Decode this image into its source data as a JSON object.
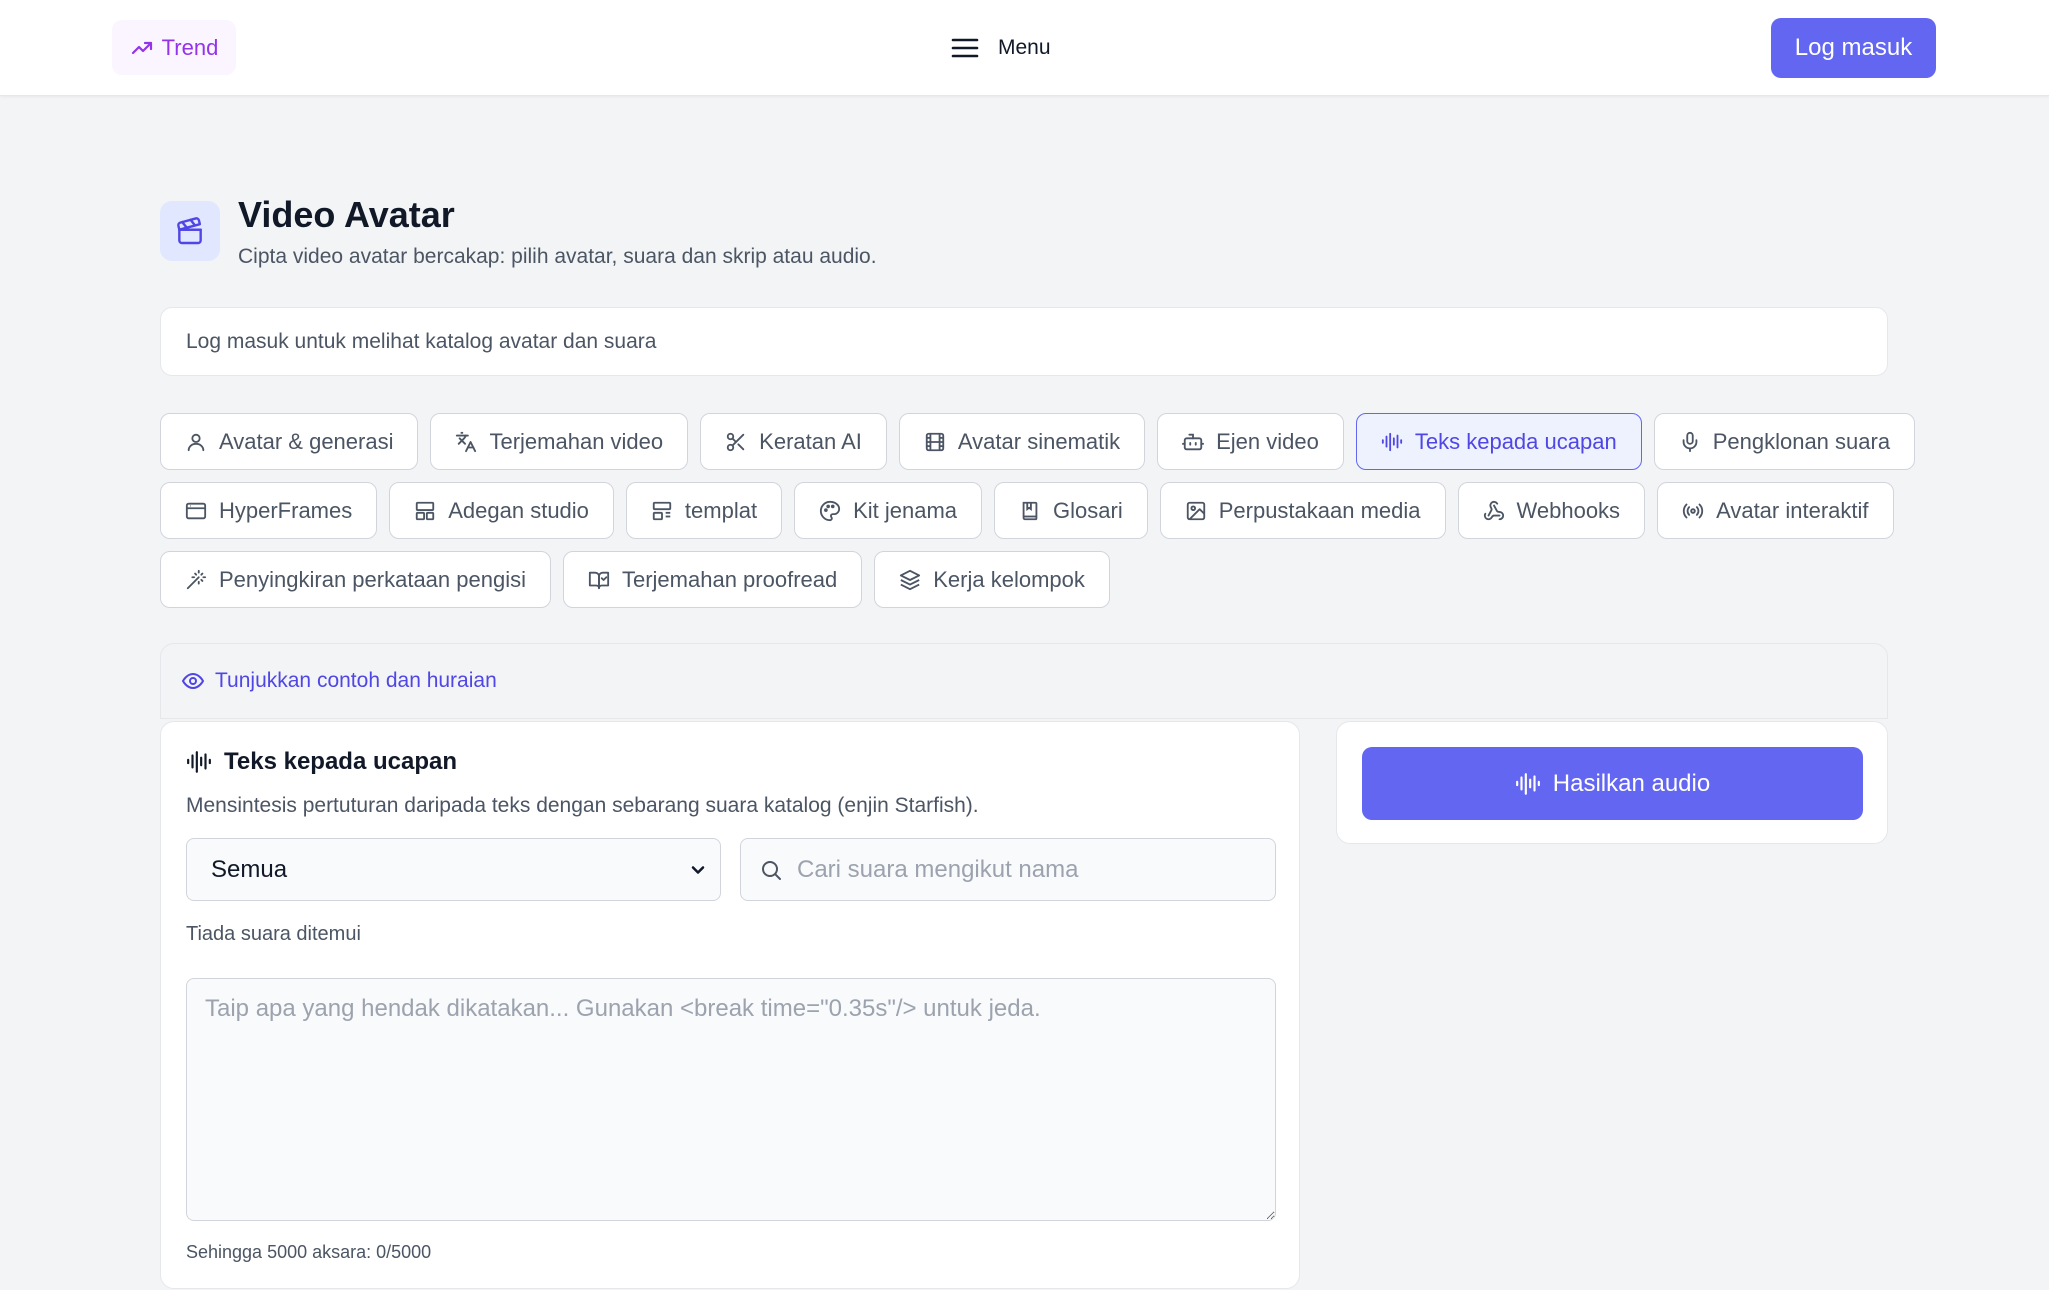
{
  "header": {
    "trend_label": "Trend",
    "menu_label": "Menu",
    "login_label": "Log masuk"
  },
  "page": {
    "title": "Video Avatar",
    "subtitle": "Cipta video avatar bercakap: pilih avatar, suara dan skrip atau audio.",
    "notice": "Log masuk untuk melihat katalog avatar dan suara"
  },
  "tabs_row1": [
    {
      "label": "Avatar & generasi",
      "icon": "user-icon"
    },
    {
      "label": "Terjemahan video",
      "icon": "translate-icon"
    },
    {
      "label": "Keratan AI",
      "icon": "scissors-icon"
    },
    {
      "label": "Avatar sinematik",
      "icon": "film-icon"
    },
    {
      "label": "Ejen video",
      "icon": "bot-icon"
    },
    {
      "label": "Teks kepada ucapan",
      "icon": "audio-wave-icon",
      "active": true
    },
    {
      "label": "Pengklonan suara",
      "icon": "microphone-icon"
    }
  ],
  "tabs_row2": [
    {
      "label": "HyperFrames",
      "icon": "browser-window-icon"
    },
    {
      "label": "Adegan studio",
      "icon": "layout-icon"
    },
    {
      "label": "templat",
      "icon": "template-icon"
    },
    {
      "label": "Kit jenama",
      "icon": "palette-icon"
    },
    {
      "label": "Glosari",
      "icon": "book-icon"
    },
    {
      "label": "Perpustakaan media",
      "icon": "image-icon"
    },
    {
      "label": "Webhooks",
      "icon": "webhook-icon"
    },
    {
      "label": "Avatar interaktif",
      "icon": "broadcast-icon"
    }
  ],
  "tabs_row3": [
    {
      "label": "Penyingkiran perkataan pengisi",
      "icon": "magic-wand-icon"
    },
    {
      "label": "Terjemahan proofread",
      "icon": "book-check-icon"
    },
    {
      "label": "Kerja kelompok",
      "icon": "layers-icon"
    }
  ],
  "examples_toggle": "Tunjukkan contoh dan huraian",
  "tts": {
    "heading": "Teks kepada ucapan",
    "description": "Mensintesis pertuturan daripada teks dengan sebarang suara katalog (enjin Starfish).",
    "filter_selected": "Semua",
    "search_placeholder": "Cari suara mengikut nama",
    "empty_message": "Tiada suara ditemui",
    "text_placeholder": "Taip apa yang hendak dikatakan... Gunakan <break time=\"0.35s\"/> untuk jeda.",
    "char_limit": "Sehingga 5000 aksara: 0/5000"
  },
  "side": {
    "generate_label": "Hasilkan audio"
  },
  "colors": {
    "accent": "#6366f1",
    "accent_text": "#4f46e5",
    "trend": "#9333ea",
    "background": "#f3f4f6"
  }
}
